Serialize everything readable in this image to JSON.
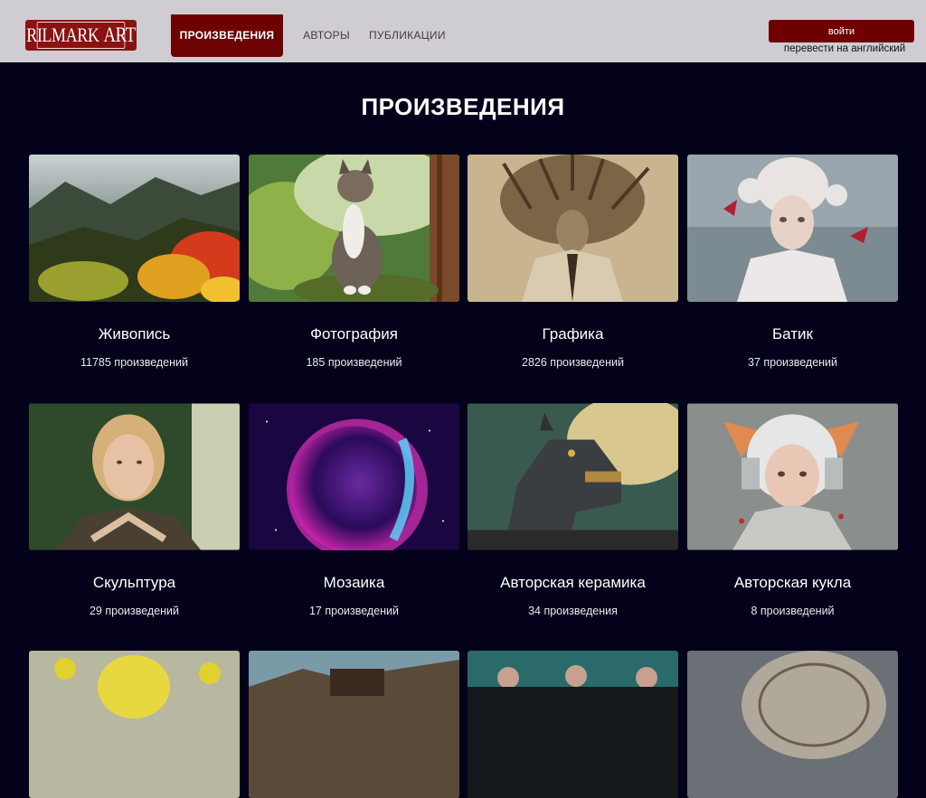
{
  "header": {
    "logo": "RILMARK ART",
    "nav": [
      {
        "label": "ПРОИЗВЕДЕНИЯ",
        "active": true
      },
      {
        "label": "АВТОРЫ",
        "active": false
      },
      {
        "label": "ПУБЛИКАЦИИ",
        "active": false
      }
    ],
    "login_label": "войти",
    "translate_label": "перевести на английский"
  },
  "main": {
    "title": "ПРОИЗВЕДЕНИЯ",
    "categories": [
      {
        "title": "Живопись",
        "count": "11785 произведений"
      },
      {
        "title": "Фотография",
        "count": "185 произведений"
      },
      {
        "title": "Графика",
        "count": "2826 произведений"
      },
      {
        "title": "Батик",
        "count": "37 произведений"
      },
      {
        "title": "Скульптура",
        "count": "29 произведений"
      },
      {
        "title": "Мозаика",
        "count": "17 произведений"
      },
      {
        "title": "Авторская керамика",
        "count": "34 произведения"
      },
      {
        "title": "Авторская кукла",
        "count": "8 произведений"
      }
    ]
  },
  "colors": {
    "accent": "#6e0000",
    "background": "#03021a",
    "header_bg": "#cfcdd2"
  }
}
